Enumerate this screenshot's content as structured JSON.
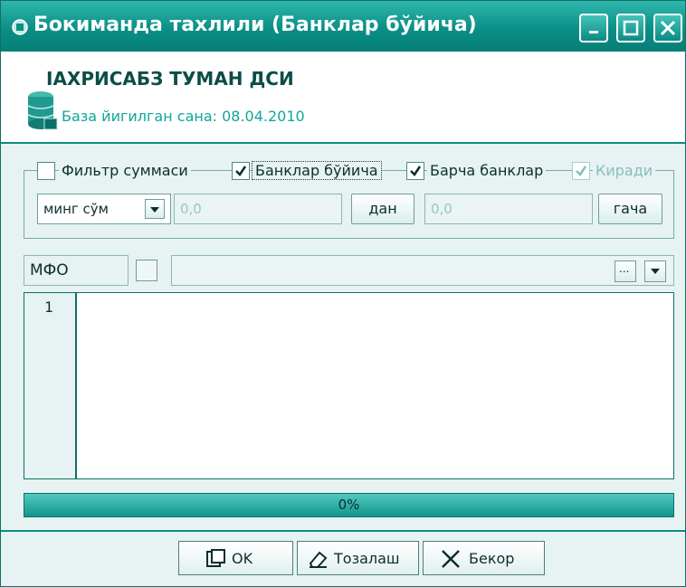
{
  "window": {
    "title": "Бокиманда тахлили (Банклар бўйича)",
    "icon": "app-icon",
    "controls": [
      "minimize-icon",
      "maximize-icon",
      "close-icon"
    ]
  },
  "header": {
    "title": "ІАХРИСАБЗ ТУМАН ДСИ",
    "subtitle": "База йигилган сана: 08.04.2010",
    "icon": "database-icon"
  },
  "filters": {
    "filter_sum_label": "Фильтр суммаси",
    "filter_sum_checked": false,
    "by_banks_label": "Банклар бўйича",
    "by_banks_checked": true,
    "all_banks_label": "Барча банклар",
    "all_banks_checked": true,
    "income_label": "Киради",
    "income_checked": true,
    "unit_value": "минг сўм",
    "from_placeholder": "0,0",
    "from_button": "дан",
    "to_placeholder": "0,0",
    "to_button": "гача"
  },
  "mfo": {
    "label": "МФО",
    "ellipsis_button": "...",
    "dropdown": "chevron-down-icon"
  },
  "editor": {
    "line_number": "1"
  },
  "progress": {
    "text": "0%",
    "value": 0
  },
  "footer": {
    "ok_label": "OK",
    "clear_label": "Тозалаш",
    "cancel_label": "Бекор"
  },
  "colors": {
    "accent": "#0b8f86",
    "background": "#e6f3f2",
    "text": "#0c2e2c"
  }
}
